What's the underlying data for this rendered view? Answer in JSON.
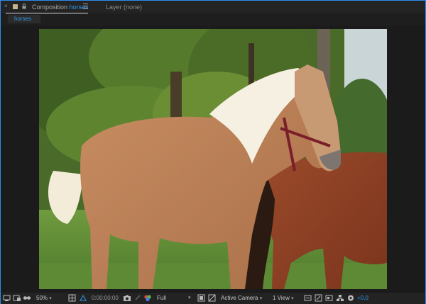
{
  "panel": {
    "composition_label": "Composition",
    "composition_name": "horses",
    "layer_label": "Layer (none)",
    "tab_label": "horses"
  },
  "toolbar": {
    "magnification": "50%",
    "timecode": "0:00:00:00",
    "resolution": "Full",
    "camera": "Active Camera",
    "view_layout": "1 View",
    "exposure": "+0,0"
  },
  "colors": {
    "accent": "#2d9ae8",
    "panel_bg": "#232323",
    "viewer_bg": "#1b1b1b"
  },
  "image": {
    "description_icon": "composition-viewer-image"
  }
}
